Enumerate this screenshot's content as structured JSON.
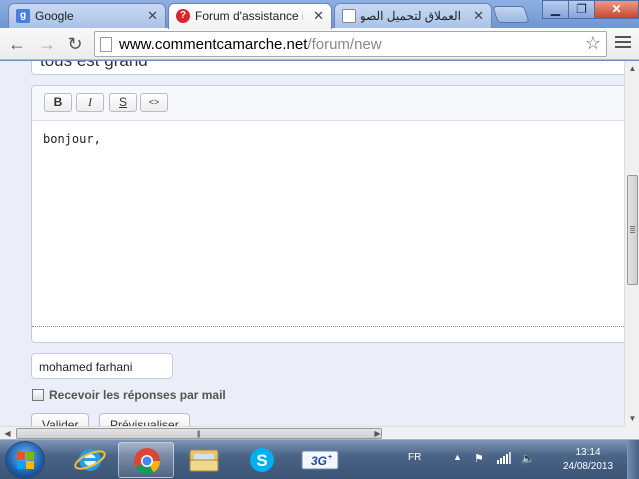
{
  "browser": {
    "tabs": [
      {
        "label": "Google",
        "favicon": "g",
        "favicon_color": "#4a7ddb"
      },
      {
        "label": "Forum d'assistance i",
        "favicon": "?",
        "favicon_color": "#d8262a"
      },
      {
        "label": "العملاق لتحميل الصور",
        "favicon": "",
        "favicon_color": "#ffffff"
      }
    ],
    "url_host": "www.commentcamarche.net",
    "url_path": "/forum/new"
  },
  "page": {
    "subject_text": "tous est grand",
    "editor_buttons": [
      "B",
      "I",
      "S",
      "<>"
    ],
    "editor_text": "bonjour,",
    "name_value": "mohamed farhani",
    "checkbox_label": "Recevoir les réponses par mail",
    "buttons": [
      "Valider",
      "Prévisualiser"
    ]
  },
  "taskbar": {
    "language": "FR",
    "time": "13:14",
    "date": "24/08/2013",
    "apps": [
      "internet-explorer",
      "chrome",
      "file-explorer",
      "skype",
      "3g-modem"
    ]
  },
  "colors": {
    "page_bg": "#ebeef8",
    "accent": "#4a7ddb"
  }
}
